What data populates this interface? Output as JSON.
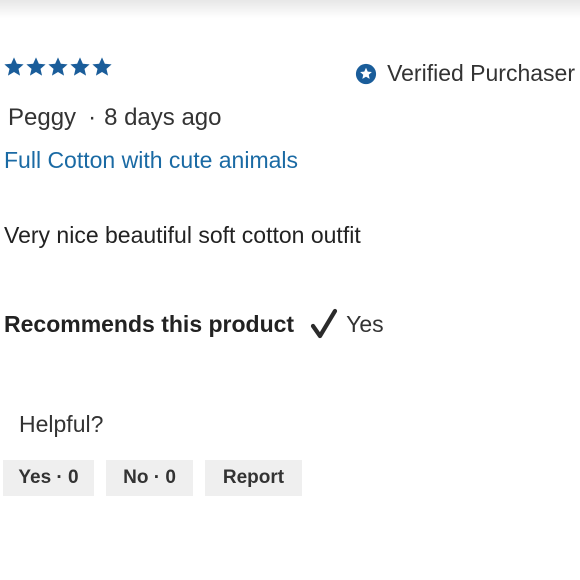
{
  "review": {
    "rating": 5,
    "rating_max": 5,
    "star_color": "#1a5d9a",
    "verified_label": "Verified Purchaser",
    "author": "Peggy",
    "separator": "·",
    "date": "8 days ago",
    "title": "Full Cotton with cute animals",
    "body": "Very nice beautiful soft cotton outfit",
    "recommends_label": "Recommends this product",
    "recommends_value": "Yes",
    "helpful_label": "Helpful?",
    "buttons": {
      "yes_label": "Yes · 0",
      "no_label": "No · 0",
      "report_label": "Report"
    },
    "icons": {
      "star": "star-icon",
      "verified": "verified-badge-icon",
      "recommend": "checkmark-icon"
    }
  }
}
